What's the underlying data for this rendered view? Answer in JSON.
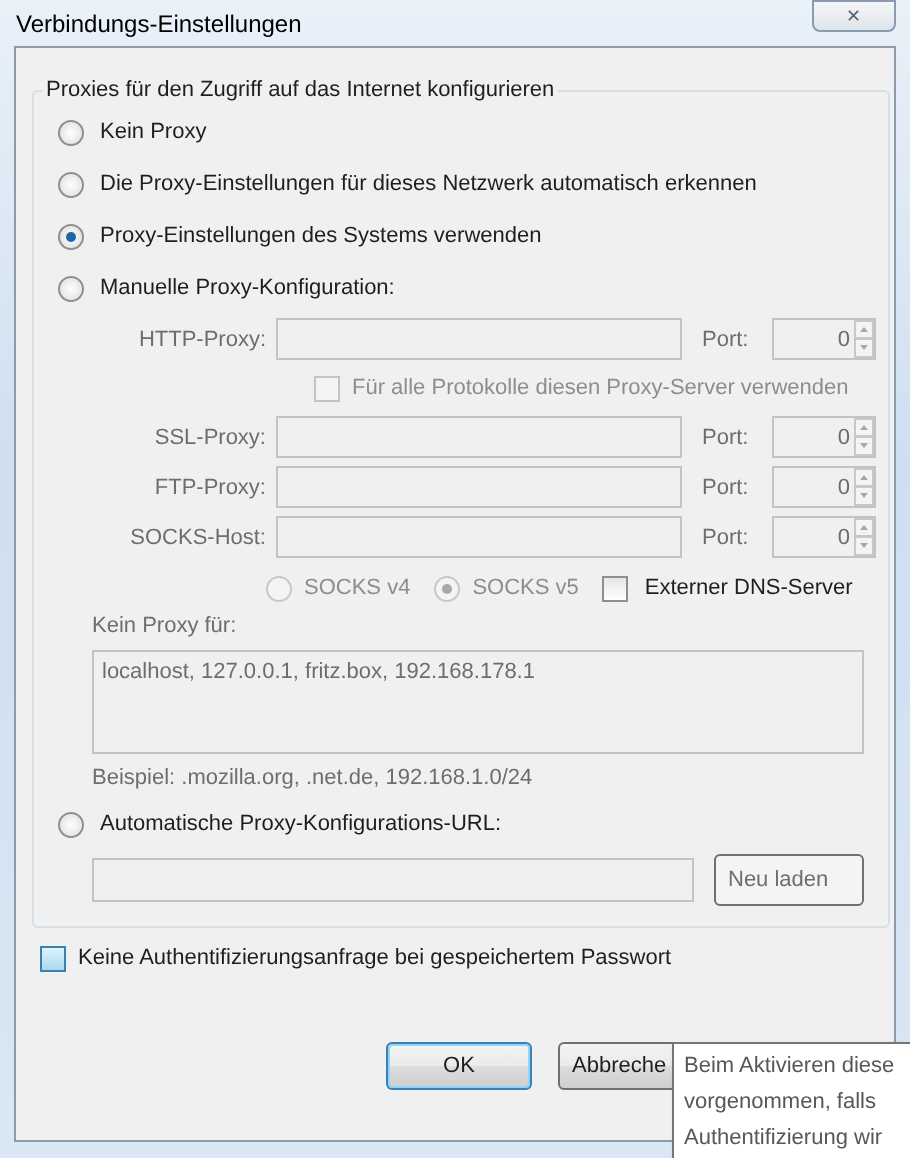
{
  "window": {
    "title": "Verbindungs-Einstellungen",
    "close_label": "✕"
  },
  "proxy_group": {
    "legend": "Proxies für den Zugriff auf das Internet konfigurieren",
    "modes": [
      {
        "label": "Kein Proxy",
        "selected": false
      },
      {
        "label": "Die Proxy-Einstellungen für dieses Netzwerk automatisch erkennen",
        "selected": false
      },
      {
        "label": "Proxy-Einstellungen des Systems verwenden",
        "selected": true
      },
      {
        "label": "Manuelle Proxy-Konfiguration:",
        "selected": false
      }
    ],
    "manual": {
      "disabled": true,
      "rows": [
        {
          "kind": "server",
          "label": "HTTP-Proxy:",
          "port_label": "Port:",
          "port": "0"
        },
        {
          "kind": "checkbox",
          "label": "Für alle Protokolle diesen Proxy-Server verwenden",
          "checked": false
        },
        {
          "kind": "server",
          "label": "SSL-Proxy:",
          "port_label": "Port:",
          "port": "0"
        },
        {
          "kind": "server",
          "label": "FTP-Proxy:",
          "port_label": "Port:",
          "port": "0"
        },
        {
          "kind": "server",
          "label": "SOCKS-Host:",
          "port_label": "Port:",
          "port": "0"
        }
      ],
      "socks_versions": [
        {
          "label": "SOCKS v4",
          "selected": false
        },
        {
          "label": "SOCKS v5",
          "selected": true
        }
      ],
      "remote_dns": {
        "label": "Externer DNS-Server",
        "checked": false,
        "disabled": false
      },
      "no_proxy_label": "Kein Proxy für:",
      "no_proxy_value": "localhost, 127.0.0.1, fritz.box, 192.168.178.1",
      "example": "Beispiel: .mozilla.org, .net.de, 192.168.1.0/24"
    },
    "auto_url": {
      "label": "Automatische Proxy-Konfigurations-URL:",
      "selected": false,
      "reload_label": "Neu laden",
      "disabled": true
    }
  },
  "auth_checkbox": {
    "label": "Keine Authentifizierungsanfrage bei gespeichertem Passwort",
    "checked": false,
    "hovered": true
  },
  "buttons": [
    {
      "label": "OK",
      "default": true
    },
    {
      "label": "Abbreche",
      "default": false
    }
  ],
  "tooltip": {
    "lines": [
      "Beim Aktivieren diese",
      "vorgenommen, falls",
      "Authentifizierung wir"
    ]
  }
}
